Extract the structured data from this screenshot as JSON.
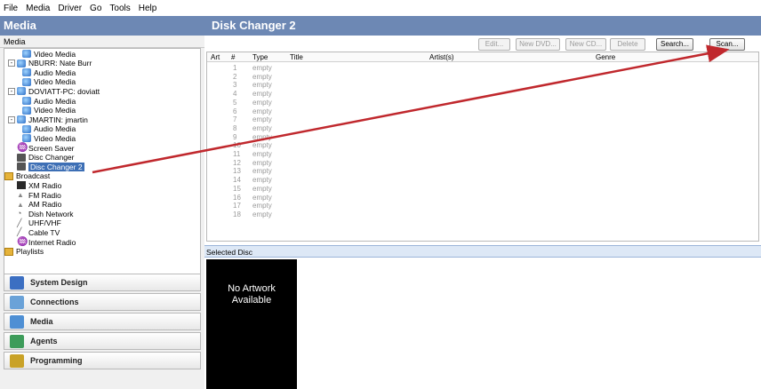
{
  "menu": [
    "File",
    "Media",
    "Driver",
    "Go",
    "Tools",
    "Help"
  ],
  "left_panel": {
    "title": "Media",
    "subtitle": "Media",
    "tree": [
      {
        "label": "Video Media",
        "level": 2,
        "icon": "media-icon",
        "toggle": ""
      },
      {
        "label": "NBURR: Nate Burr",
        "level": 1,
        "icon": "media-icon",
        "toggle": "-"
      },
      {
        "label": "Audio Media",
        "level": 2,
        "icon": "media-icon",
        "toggle": ""
      },
      {
        "label": "Video Media",
        "level": 2,
        "icon": "media-icon",
        "toggle": ""
      },
      {
        "label": "DOVIATT-PC: doviatt",
        "level": 1,
        "icon": "media-icon",
        "toggle": "-"
      },
      {
        "label": "Audio Media",
        "level": 2,
        "icon": "media-icon",
        "toggle": ""
      },
      {
        "label": "Video Media",
        "level": 2,
        "icon": "media-icon",
        "toggle": ""
      },
      {
        "label": "JMARTIN: jmartin",
        "level": 1,
        "icon": "media-icon",
        "toggle": "-"
      },
      {
        "label": "Audio Media",
        "level": 2,
        "icon": "media-icon",
        "toggle": ""
      },
      {
        "label": "Video Media",
        "level": 2,
        "icon": "media-icon",
        "toggle": ""
      },
      {
        "label": "Screen Saver",
        "level": 1,
        "icon": "screen-saver-icon",
        "toggle": ""
      },
      {
        "label": "Disc Changer",
        "level": 1,
        "icon": "disc-changer-icon",
        "toggle": ""
      },
      {
        "label": "Disc Changer 2",
        "level": 1,
        "icon": "disc-changer-icon",
        "toggle": "",
        "selected": true
      },
      {
        "label": "Broadcast",
        "level": 0,
        "icon": "folder-icon",
        "toggle": ""
      },
      {
        "label": "XM Radio",
        "level": 1,
        "icon": "xm-radio-icon",
        "toggle": ""
      },
      {
        "label": "FM Radio",
        "level": 1,
        "icon": "fm-radio-icon",
        "toggle": ""
      },
      {
        "label": "AM Radio",
        "level": 1,
        "icon": "am-radio-icon",
        "toggle": ""
      },
      {
        "label": "Dish Network",
        "level": 1,
        "icon": "dish-icon",
        "toggle": ""
      },
      {
        "label": "UHF/VHF",
        "level": 1,
        "icon": "antenna-icon",
        "toggle": ""
      },
      {
        "label": "Cable TV",
        "level": 1,
        "icon": "cable-icon",
        "toggle": ""
      },
      {
        "label": "Internet Radio",
        "level": 1,
        "icon": "internet-radio-icon",
        "toggle": ""
      },
      {
        "label": "Playlists",
        "level": 0,
        "icon": "folder-icon",
        "toggle": ""
      }
    ],
    "nav_buttons": [
      {
        "label": "System Design",
        "icon": "system-design-icon",
        "color": "#3c6fc2"
      },
      {
        "label": "Connections",
        "icon": "connections-icon",
        "color": "#6aa2d8"
      },
      {
        "label": "Media",
        "icon": "media-nav-icon",
        "color": "#4e8fd4"
      },
      {
        "label": "Agents",
        "icon": "agents-icon",
        "color": "#3d9c5a"
      },
      {
        "label": "Programming",
        "icon": "programming-icon",
        "color": "#c9a227"
      }
    ]
  },
  "right_panel": {
    "title": "Disk Changer 2",
    "buttons": {
      "edit": "Edit...",
      "new_dvd": "New DVD...",
      "new_cd": "New CD...",
      "delete": "Delete",
      "search": "Search...",
      "scan": "Scan..."
    },
    "columns": [
      "Art",
      "#",
      "Type",
      "Title",
      "Artist(s)",
      "Genre"
    ],
    "rows": [
      {
        "num": "1",
        "type": "empty"
      },
      {
        "num": "2",
        "type": "empty"
      },
      {
        "num": "3",
        "type": "empty"
      },
      {
        "num": "4",
        "type": "empty"
      },
      {
        "num": "5",
        "type": "empty"
      },
      {
        "num": "6",
        "type": "empty"
      },
      {
        "num": "7",
        "type": "empty"
      },
      {
        "num": "8",
        "type": "empty"
      },
      {
        "num": "9",
        "type": "empty"
      },
      {
        "num": "10",
        "type": "empty"
      },
      {
        "num": "11",
        "type": "empty"
      },
      {
        "num": "12",
        "type": "empty"
      },
      {
        "num": "13",
        "type": "empty"
      },
      {
        "num": "14",
        "type": "empty"
      },
      {
        "num": "15",
        "type": "empty"
      },
      {
        "num": "16",
        "type": "empty"
      },
      {
        "num": "17",
        "type": "empty"
      },
      {
        "num": "18",
        "type": "empty"
      }
    ],
    "selected_disc_label": "Selected Disc",
    "artwork_text": "No Artwork Available"
  },
  "annotation": {
    "color": "#c0282d"
  }
}
